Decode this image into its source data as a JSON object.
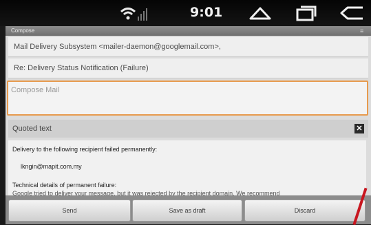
{
  "status_bar": {
    "time": "9:01",
    "icons": [
      "wifi-icon",
      "signal-icon",
      "home-icon",
      "recent-apps-icon",
      "back-icon"
    ]
  },
  "window": {
    "title": "Compose",
    "to_field": "Mail Delivery Subsystem <mailer-daemon@googlemail.com>,",
    "subject_field": "Re: Delivery Status Notification (Failure)",
    "compose_placeholder": "Compose Mail",
    "quoted_text_label": "Quoted text",
    "quoted_lines": {
      "line1": "Delivery to the following recipient failed permanently:",
      "recipient": "lkngin@mapit.com.my",
      "details_heading": "Technical details of permanent failure:",
      "details_text": "Google tried to deliver your message, but it was rejected by the recipient domain. We recommend"
    }
  },
  "buttons": {
    "send": "Send",
    "save_draft": "Save as draft",
    "discard": "Discard"
  },
  "colors": {
    "compose_focus_border": "#e79a4d",
    "window_bg": "#dcdcdc",
    "status_bar_bg": "#050505"
  }
}
